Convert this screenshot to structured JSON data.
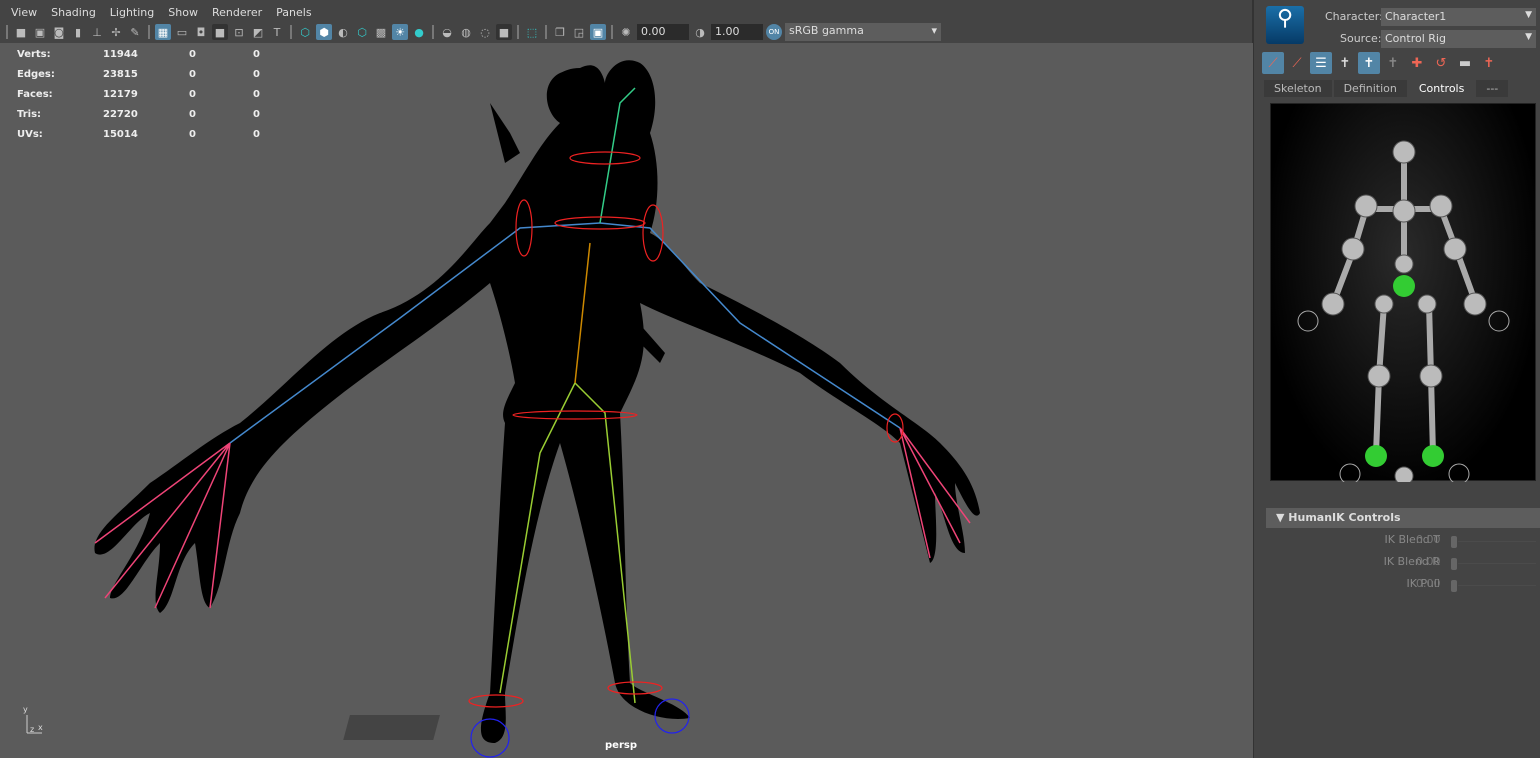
{
  "menu": [
    "View",
    "Shading",
    "Lighting",
    "Show",
    "Renderer",
    "Panels"
  ],
  "toolbar": {
    "exposure": "0.00",
    "gamma": "1.00",
    "colorspace": "sRGB gamma",
    "on_label": "ON"
  },
  "stats": [
    {
      "label": "Verts:",
      "v1": "11944",
      "v2": "0",
      "v3": "0"
    },
    {
      "label": "Edges:",
      "v1": "23815",
      "v2": "0",
      "v3": "0"
    },
    {
      "label": "Faces:",
      "v1": "12179",
      "v2": "0",
      "v3": "0"
    },
    {
      "label": "Tris:",
      "v1": "22720",
      "v2": "0",
      "v3": "0"
    },
    {
      "label": "UVs:",
      "v1": "15014",
      "v2": "0",
      "v3": "0"
    }
  ],
  "camera": "persp",
  "axis": {
    "y": "y",
    "x": "x",
    "z": "z"
  },
  "hik": {
    "character_label": "Character:",
    "character": "Character1",
    "source_label": "Source:",
    "source": "Control Rig",
    "tabs": [
      "Skeleton",
      "Definition",
      "Controls",
      "---"
    ],
    "section": "HumanIK Controls",
    "controls": [
      {
        "label": "IK Blend T",
        "value": "0.00"
      },
      {
        "label": "IK Blend R",
        "value": "0.00"
      },
      {
        "label": "IK Pull",
        "value": "0.00"
      }
    ]
  }
}
